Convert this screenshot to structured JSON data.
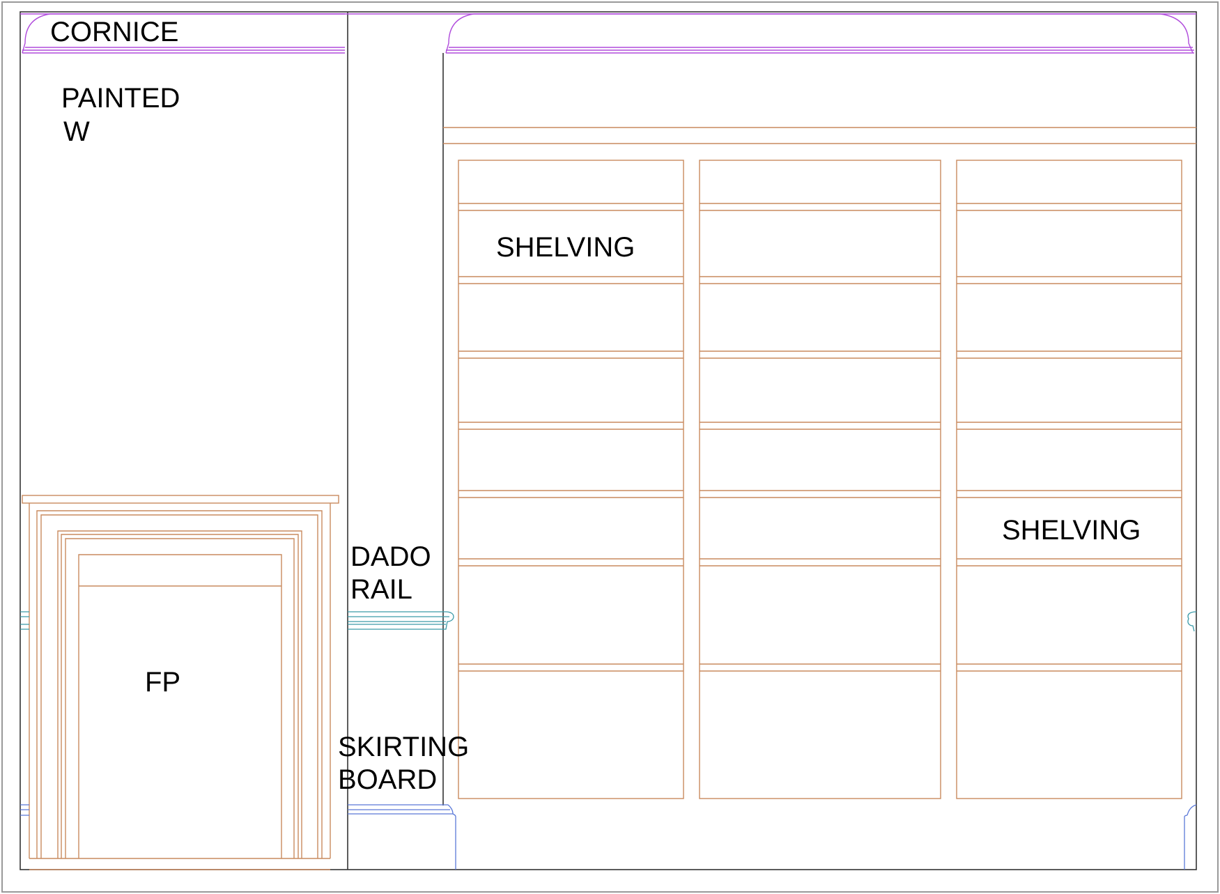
{
  "labels": {
    "cornice": "CORNICE",
    "painted_line1": "PAINTED",
    "painted_line2": "W",
    "shelving_upper": "SHELVING",
    "shelving_lower": "SHELVING",
    "dado_line1": "DADO",
    "dado_line2": "RAIL",
    "fireplace": "FP",
    "skirting_line1": "SKIRTING",
    "skirting_line2": "BOARD"
  },
  "colors": {
    "wall_outline": "#333333",
    "sheet_border": "#999999",
    "cornice": "#b04cdc",
    "joinery": "#c98a5e",
    "dado_rail": "#3a9aa8",
    "skirting": "#5a78d8"
  }
}
